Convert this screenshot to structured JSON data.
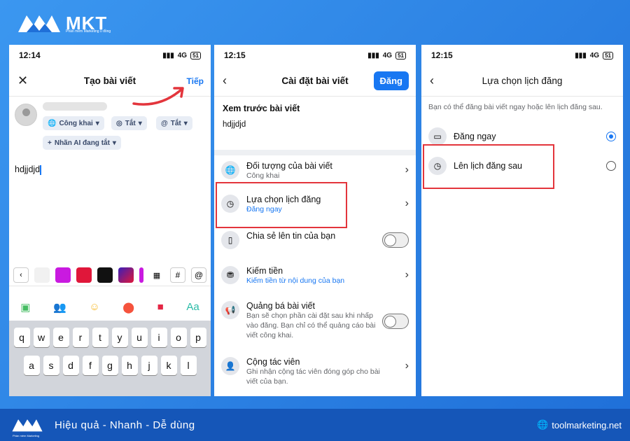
{
  "brand": {
    "name": "MKT",
    "tagline": "Phần mềm Marketing 0 đồng",
    "footer_slogan": "Hiệu quả - Nhanh - Dễ dùng",
    "footer_site": "toolmarketing.net",
    "footer_logo_sub": "Phần mềm Marketing"
  },
  "phone1": {
    "time": "12:14",
    "network": "4G",
    "battery": "51",
    "title": "Tạo bài viết",
    "next": "Tiếp",
    "chips": [
      "Công khai",
      "Tắt",
      "Tắt",
      "Nhãn AI đang tắt"
    ],
    "post_text": "hdjjdjd",
    "colors": [
      "#f1f1f1",
      "#c91ae0",
      "#e0173a",
      "#111111",
      "#7a1fc2"
    ],
    "keys_row1": [
      "q",
      "w",
      "e",
      "r",
      "t",
      "y",
      "u",
      "i",
      "o",
      "p"
    ],
    "keys_row2": [
      "a",
      "s",
      "d",
      "f",
      "g",
      "h",
      "j",
      "k",
      "l"
    ],
    "color_hash": "#",
    "color_at": "@"
  },
  "phone2": {
    "time": "12:15",
    "network": "4G",
    "battery": "51",
    "title": "Cài đặt bài viết",
    "post_btn": "Đăng",
    "preview_heading": "Xem trước bài viết",
    "preview_text": "hdjjdjd",
    "rows": [
      {
        "title": "Đối tượng của bài viết",
        "sub": "Công khai"
      },
      {
        "title": "Lựa chọn lịch đăng",
        "sub": "Đăng ngay"
      },
      {
        "title": "Chia sẻ lên tin của bạn",
        "sub": ""
      },
      {
        "title": "Kiếm tiền",
        "sub": "Kiếm tiền từ nội dung của bạn"
      },
      {
        "title": "Quảng bá bài viết",
        "sub": "Bạn sẽ chọn phần cài đặt sau khi nhấp vào đăng. Bạn chỉ có thể quảng cáo bài viết công khai."
      },
      {
        "title": "Cộng tác viên",
        "sub": "Ghi nhận cộng tác viên đóng góp cho bài viết của bạn."
      }
    ]
  },
  "phone3": {
    "time": "12:15",
    "network": "4G",
    "battery": "51",
    "title": "Lựa chọn lịch đăng",
    "description": "Bạn có thể đăng bài viết ngay hoặc lên lịch đăng sau.",
    "options": [
      {
        "label": "Đăng ngay",
        "selected": true
      },
      {
        "label": "Lên lịch đăng sau",
        "selected": false
      }
    ]
  },
  "colors": {
    "accent": "#1877f2",
    "highlight": "#e3353c",
    "arrow": "#e3353c"
  }
}
